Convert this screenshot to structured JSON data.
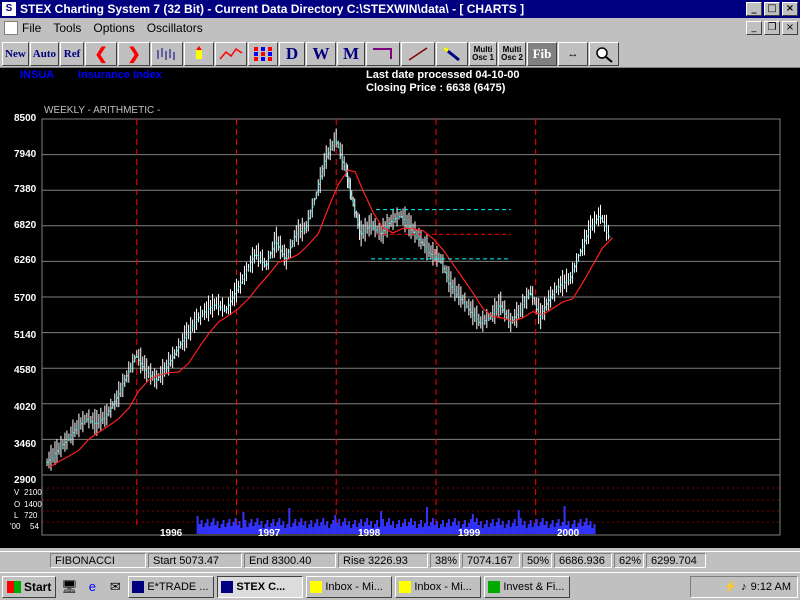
{
  "window": {
    "title": "STEX Charting System 7 (32 Bit)  - Current Data Directory C:\\STEXWIN\\data\\ - [  CHARTS   ]"
  },
  "menu": [
    "File",
    "Tools",
    "Options",
    "Oscillators"
  ],
  "toolbar": {
    "new": "New",
    "auto": "Auto",
    "ref": "Ref",
    "d": "D",
    "w": "W",
    "m": "M",
    "multi_osc1_a": "Multi",
    "multi_osc1_b": "Osc 1",
    "multi_osc2_a": "Multi",
    "multi_osc2_b": "Osc 2",
    "fib": "Fib"
  },
  "chart_header": {
    "symbol": "INSUA",
    "name": "Insurance Index",
    "last_date": "Last date processed 04-10-00",
    "closing": "Closing Price : 6638  (6475)",
    "mode": "WEEKLY  - ARITHMETIC -"
  },
  "chart_data": {
    "type": "line",
    "title": "",
    "xlabel": "",
    "ylabel": "",
    "ylim": [
      2900,
      8500
    ],
    "y_ticks": [
      8500,
      7940,
      7380,
      6820,
      6260,
      5700,
      5140,
      4580,
      4020,
      3460,
      2900
    ],
    "x_ticks": [
      "1996",
      "1997",
      "1998",
      "1999",
      "2000"
    ],
    "year_boundaries": [
      1996,
      1997,
      1998,
      1999,
      2000
    ],
    "series": [
      {
        "color": "#ffffff",
        "x": [
          1995.05,
          1995.15,
          1995.25,
          1995.35,
          1995.45,
          1995.55,
          1995.65,
          1995.75,
          1995.85,
          1995.95,
          1996.05,
          1996.15,
          1996.25,
          1996.35,
          1996.45,
          1996.55,
          1996.65,
          1996.75,
          1996.85,
          1996.95,
          1997.05,
          1997.15,
          1997.25,
          1997.35,
          1997.45,
          1997.55,
          1997.65,
          1997.75,
          1997.85,
          1997.95,
          1998.05,
          1998.12,
          1998.2,
          1998.3,
          1998.4,
          1998.5,
          1998.6,
          1998.7,
          1998.8,
          1998.9,
          1999.0,
          1999.1,
          1999.2,
          1999.3,
          1999.4,
          1999.5,
          1999.6,
          1999.7,
          1999.8,
          1999.9,
          2000.0,
          2000.1,
          2000.2,
          2000.3,
          2000.4,
          2000.5,
          2000.6,
          2000.7
        ],
        "values": [
          3100,
          3280,
          3450,
          3650,
          3800,
          3720,
          3850,
          4100,
          4450,
          4800,
          4550,
          4400,
          4600,
          4850,
          5100,
          5350,
          5500,
          5600,
          5500,
          5800,
          6100,
          6400,
          6200,
          6600,
          6300,
          6700,
          6800,
          7300,
          7900,
          8200,
          7700,
          7200,
          6700,
          6850,
          6700,
          6900,
          7000,
          6800,
          6600,
          6400,
          6300,
          5900,
          5700,
          5500,
          5300,
          5400,
          5600,
          5300,
          5500,
          5800,
          5400,
          5700,
          5900,
          6000,
          6400,
          6800,
          7000,
          6650
        ]
      }
    ],
    "volume_levels": [
      "2100",
      "1400",
      "720",
      "54"
    ],
    "volume_labels": [
      "V",
      "O",
      "L",
      "'00"
    ]
  },
  "status": {
    "mode": "FIBONACCI",
    "start": "Start  5073.47",
    "end": "End    8300.40",
    "rise": "Rise   3226.93",
    "p38": "38%",
    "v38": "7074.167",
    "p50": "50%",
    "v50": "6686.936",
    "p62": "62%",
    "v62": "6299.704"
  },
  "taskbar": {
    "start": "Start",
    "tasks": [
      "E*TRADE ...",
      "STEX C...",
      "Inbox - Mi...",
      "Inbox - Mi...",
      "Invest & Fi..."
    ],
    "clock": "9:12 AM"
  }
}
